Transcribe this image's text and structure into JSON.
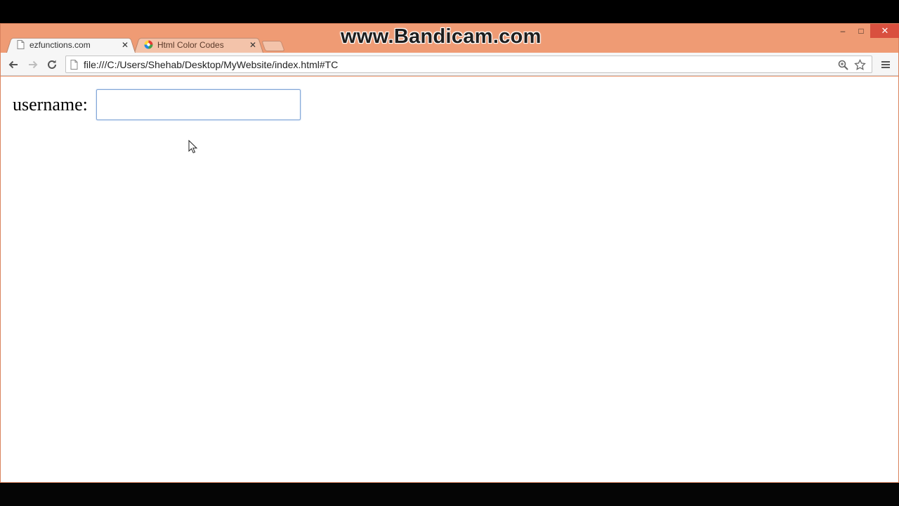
{
  "watermark": "www.Bandicam.com",
  "browser": {
    "tabs": [
      {
        "title": "ezfunctions.com",
        "active": true,
        "favicon": "page-icon"
      },
      {
        "title": "Html Color Codes",
        "active": false,
        "favicon": "color-wheel-icon"
      }
    ],
    "address_bar": {
      "url": "file:///C:/Users/Shehab/Desktop/MyWebsite/index.html#TC"
    },
    "window_controls": {
      "minimize": "–",
      "maximize": "□",
      "close": "✕"
    },
    "colors": {
      "frame": "#ef9b74",
      "close_button": "#d9503f",
      "input_focus": "#7fa4d6"
    }
  },
  "page": {
    "form": {
      "username_label": "username:",
      "username_value": ""
    }
  }
}
